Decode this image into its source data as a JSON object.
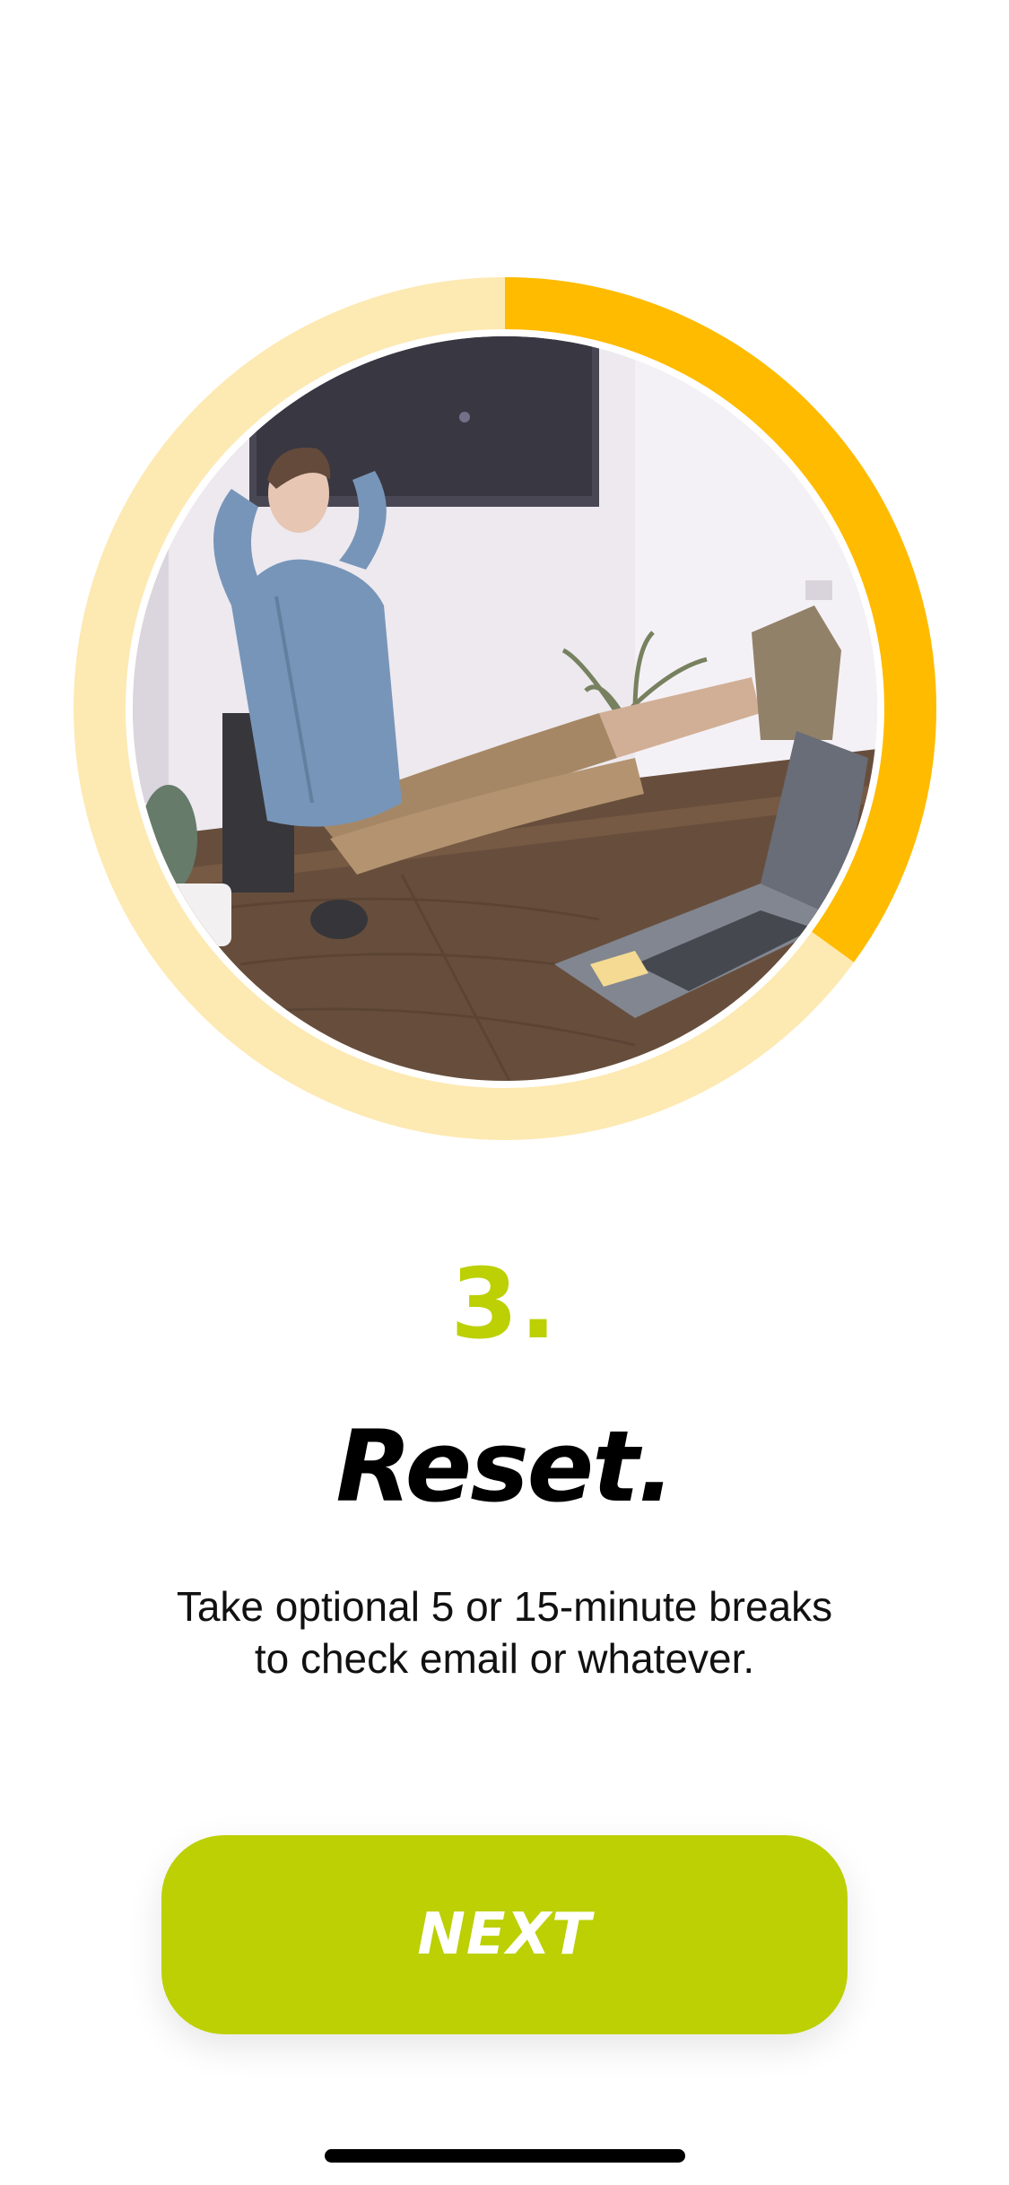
{
  "onboarding": {
    "step_number": "3.",
    "title": "Reset.",
    "description_lines": [
      "Take optional 5 or 15-minute breaks",
      "to check email or whatever."
    ],
    "progress_fraction": 0.35,
    "illustration_icon": "person-relaxing-at-desk-photo"
  },
  "actions": {
    "next_label": "NEXT"
  },
  "colors": {
    "ring_track": "#fde9b2",
    "ring_progress": "#ffbb00",
    "accent_green": "#bcd003",
    "title_black": "#000000"
  }
}
